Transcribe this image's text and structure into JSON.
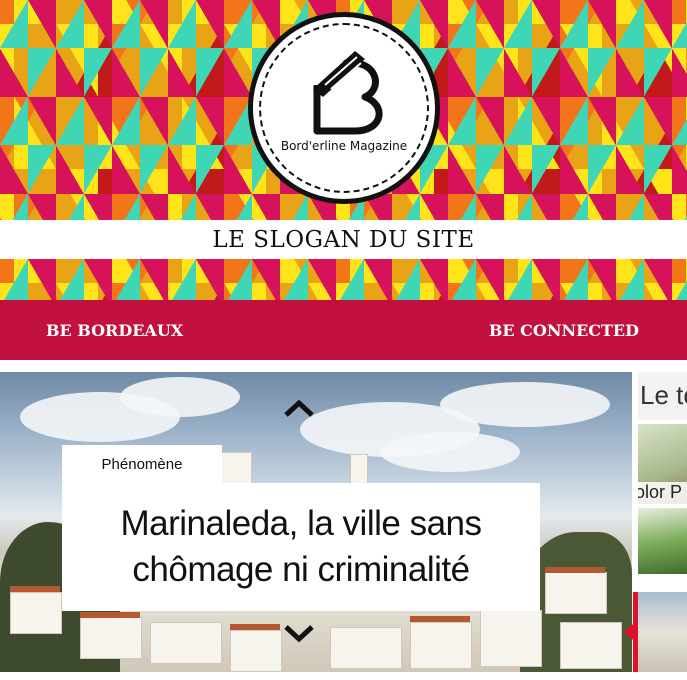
{
  "site": {
    "logo_text": "Bord'erline Magazine",
    "slogan": "LE SLOGAN DU SITE"
  },
  "nav": {
    "left_label": "BE BORDEAUX",
    "right_label": "BE CONNECTED"
  },
  "featured": {
    "category": "Phénomène",
    "title": "Marinaleda, la ville sans chômage ni criminalité"
  },
  "thumbs": [
    {
      "caption": "Le to"
    },
    {
      "caption": "olor P"
    },
    {
      "caption": ""
    },
    {
      "caption": ""
    }
  ],
  "colors": {
    "accent": "#c2103f",
    "active_marker": "#e0122a"
  },
  "icons": {
    "up": "chevron-up-icon",
    "down": "chevron-down-icon"
  }
}
